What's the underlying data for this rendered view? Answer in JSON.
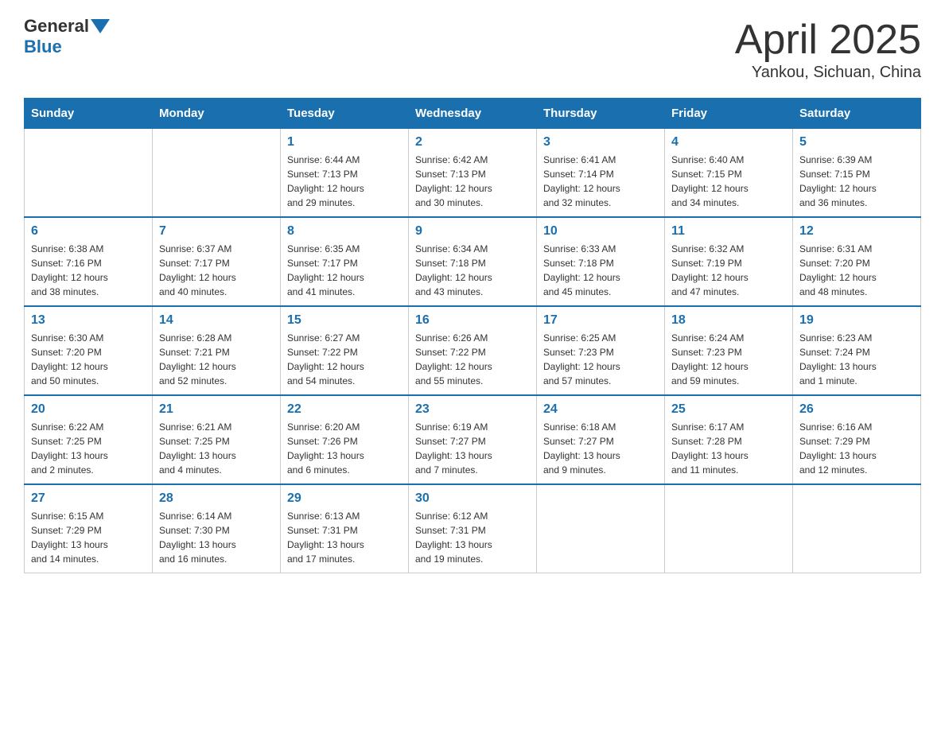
{
  "header": {
    "logo_general": "General",
    "logo_blue": "Blue",
    "title": "April 2025",
    "subtitle": "Yankou, Sichuan, China"
  },
  "days_of_week": [
    "Sunday",
    "Monday",
    "Tuesday",
    "Wednesday",
    "Thursday",
    "Friday",
    "Saturday"
  ],
  "weeks": [
    [
      {
        "day": "",
        "info": ""
      },
      {
        "day": "",
        "info": ""
      },
      {
        "day": "1",
        "info": "Sunrise: 6:44 AM\nSunset: 7:13 PM\nDaylight: 12 hours\nand 29 minutes."
      },
      {
        "day": "2",
        "info": "Sunrise: 6:42 AM\nSunset: 7:13 PM\nDaylight: 12 hours\nand 30 minutes."
      },
      {
        "day": "3",
        "info": "Sunrise: 6:41 AM\nSunset: 7:14 PM\nDaylight: 12 hours\nand 32 minutes."
      },
      {
        "day": "4",
        "info": "Sunrise: 6:40 AM\nSunset: 7:15 PM\nDaylight: 12 hours\nand 34 minutes."
      },
      {
        "day": "5",
        "info": "Sunrise: 6:39 AM\nSunset: 7:15 PM\nDaylight: 12 hours\nand 36 minutes."
      }
    ],
    [
      {
        "day": "6",
        "info": "Sunrise: 6:38 AM\nSunset: 7:16 PM\nDaylight: 12 hours\nand 38 minutes."
      },
      {
        "day": "7",
        "info": "Sunrise: 6:37 AM\nSunset: 7:17 PM\nDaylight: 12 hours\nand 40 minutes."
      },
      {
        "day": "8",
        "info": "Sunrise: 6:35 AM\nSunset: 7:17 PM\nDaylight: 12 hours\nand 41 minutes."
      },
      {
        "day": "9",
        "info": "Sunrise: 6:34 AM\nSunset: 7:18 PM\nDaylight: 12 hours\nand 43 minutes."
      },
      {
        "day": "10",
        "info": "Sunrise: 6:33 AM\nSunset: 7:18 PM\nDaylight: 12 hours\nand 45 minutes."
      },
      {
        "day": "11",
        "info": "Sunrise: 6:32 AM\nSunset: 7:19 PM\nDaylight: 12 hours\nand 47 minutes."
      },
      {
        "day": "12",
        "info": "Sunrise: 6:31 AM\nSunset: 7:20 PM\nDaylight: 12 hours\nand 48 minutes."
      }
    ],
    [
      {
        "day": "13",
        "info": "Sunrise: 6:30 AM\nSunset: 7:20 PM\nDaylight: 12 hours\nand 50 minutes."
      },
      {
        "day": "14",
        "info": "Sunrise: 6:28 AM\nSunset: 7:21 PM\nDaylight: 12 hours\nand 52 minutes."
      },
      {
        "day": "15",
        "info": "Sunrise: 6:27 AM\nSunset: 7:22 PM\nDaylight: 12 hours\nand 54 minutes."
      },
      {
        "day": "16",
        "info": "Sunrise: 6:26 AM\nSunset: 7:22 PM\nDaylight: 12 hours\nand 55 minutes."
      },
      {
        "day": "17",
        "info": "Sunrise: 6:25 AM\nSunset: 7:23 PM\nDaylight: 12 hours\nand 57 minutes."
      },
      {
        "day": "18",
        "info": "Sunrise: 6:24 AM\nSunset: 7:23 PM\nDaylight: 12 hours\nand 59 minutes."
      },
      {
        "day": "19",
        "info": "Sunrise: 6:23 AM\nSunset: 7:24 PM\nDaylight: 13 hours\nand 1 minute."
      }
    ],
    [
      {
        "day": "20",
        "info": "Sunrise: 6:22 AM\nSunset: 7:25 PM\nDaylight: 13 hours\nand 2 minutes."
      },
      {
        "day": "21",
        "info": "Sunrise: 6:21 AM\nSunset: 7:25 PM\nDaylight: 13 hours\nand 4 minutes."
      },
      {
        "day": "22",
        "info": "Sunrise: 6:20 AM\nSunset: 7:26 PM\nDaylight: 13 hours\nand 6 minutes."
      },
      {
        "day": "23",
        "info": "Sunrise: 6:19 AM\nSunset: 7:27 PM\nDaylight: 13 hours\nand 7 minutes."
      },
      {
        "day": "24",
        "info": "Sunrise: 6:18 AM\nSunset: 7:27 PM\nDaylight: 13 hours\nand 9 minutes."
      },
      {
        "day": "25",
        "info": "Sunrise: 6:17 AM\nSunset: 7:28 PM\nDaylight: 13 hours\nand 11 minutes."
      },
      {
        "day": "26",
        "info": "Sunrise: 6:16 AM\nSunset: 7:29 PM\nDaylight: 13 hours\nand 12 minutes."
      }
    ],
    [
      {
        "day": "27",
        "info": "Sunrise: 6:15 AM\nSunset: 7:29 PM\nDaylight: 13 hours\nand 14 minutes."
      },
      {
        "day": "28",
        "info": "Sunrise: 6:14 AM\nSunset: 7:30 PM\nDaylight: 13 hours\nand 16 minutes."
      },
      {
        "day": "29",
        "info": "Sunrise: 6:13 AM\nSunset: 7:31 PM\nDaylight: 13 hours\nand 17 minutes."
      },
      {
        "day": "30",
        "info": "Sunrise: 6:12 AM\nSunset: 7:31 PM\nDaylight: 13 hours\nand 19 minutes."
      },
      {
        "day": "",
        "info": ""
      },
      {
        "day": "",
        "info": ""
      },
      {
        "day": "",
        "info": ""
      }
    ]
  ]
}
